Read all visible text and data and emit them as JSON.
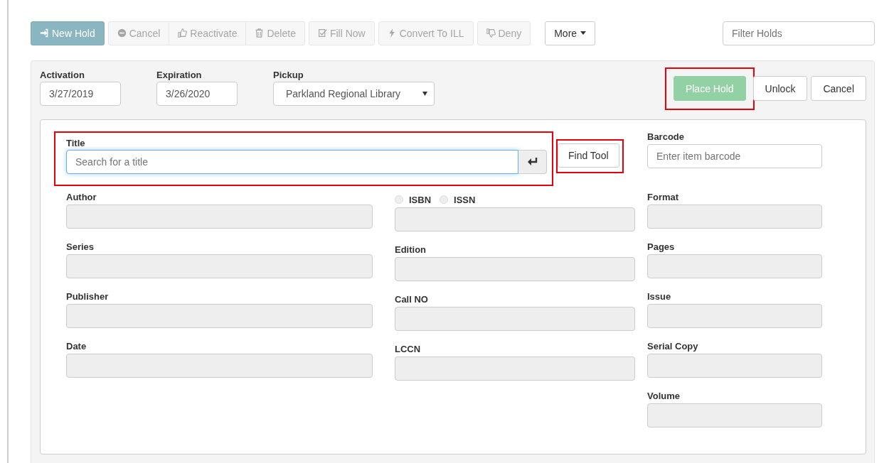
{
  "toolbar": {
    "groups": [
      [
        {
          "label": "New Hold",
          "kind": "primary",
          "disabled": false
        }
      ],
      [
        {
          "label": "Cancel",
          "kind": "default",
          "disabled": true
        },
        {
          "label": "Reactivate",
          "kind": "default",
          "disabled": true
        },
        {
          "label": "Delete",
          "kind": "default",
          "disabled": true
        }
      ],
      [
        {
          "label": "Fill Now",
          "kind": "default",
          "disabled": true
        }
      ],
      [
        {
          "label": "Convert To ILL",
          "kind": "default",
          "disabled": true
        }
      ],
      [
        {
          "label": "Deny",
          "kind": "default",
          "disabled": true
        }
      ]
    ],
    "more": {
      "label": "More"
    },
    "filter": {
      "placeholder": "Filter Holds"
    }
  },
  "hold_form": {
    "activation": {
      "label": "Activation",
      "value": "3/27/2019"
    },
    "expiration": {
      "label": "Expiration",
      "value": "3/26/2020"
    },
    "pickup": {
      "label": "Pickup",
      "value": "Parkland Regional Library"
    },
    "actions": [
      {
        "label": "Place Hold",
        "kind": "success",
        "disabled": true,
        "highlighted": true
      },
      {
        "label": "Unlock",
        "kind": "default",
        "disabled": false,
        "highlighted": false
      },
      {
        "label": "Cancel",
        "kind": "default",
        "disabled": false,
        "highlighted": false
      }
    ]
  },
  "item_search": {
    "title": {
      "label": "Title",
      "placeholder": "Search for a title",
      "highlighted": true
    },
    "find_tool": {
      "label": "Find Tool",
      "highlighted": true
    },
    "barcode": {
      "label": "Barcode",
      "placeholder": "Enter item barcode"
    },
    "columns": [
      [
        {
          "kind": "field",
          "label": "Author"
        },
        {
          "kind": "field",
          "label": "Series"
        },
        {
          "kind": "field",
          "label": "Publisher"
        },
        {
          "kind": "field",
          "label": "Date"
        }
      ],
      [
        {
          "kind": "radios",
          "options": [
            {
              "label": "ISBN",
              "selected": false
            },
            {
              "label": "ISSN",
              "selected": false
            }
          ]
        },
        {
          "kind": "field",
          "label": "Edition"
        },
        {
          "kind": "field",
          "label": "Call NO"
        },
        {
          "kind": "field",
          "label": "LCCN"
        }
      ],
      [
        {
          "kind": "field",
          "label": "Format"
        },
        {
          "kind": "field",
          "label": "Pages"
        },
        {
          "kind": "field",
          "label": "Issue"
        },
        {
          "kind": "field",
          "label": "Serial Copy"
        },
        {
          "kind": "field",
          "label": "Volume"
        }
      ]
    ]
  }
}
